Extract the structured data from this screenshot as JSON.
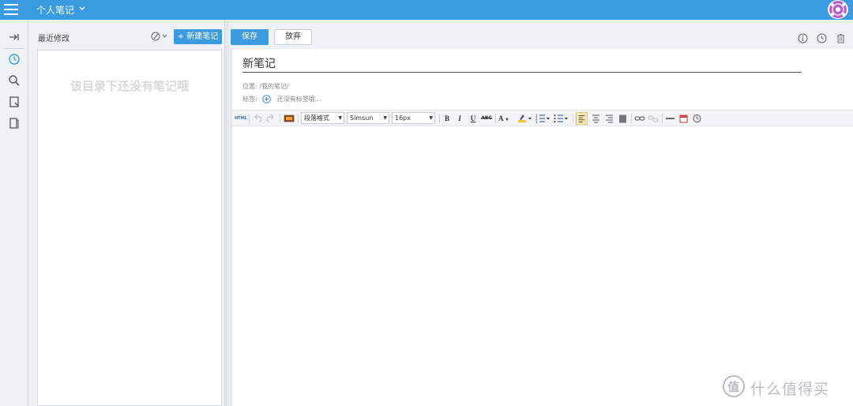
{
  "header": {
    "title": "个人笔记",
    "icons": {
      "menu": "hamburger-menu-icon",
      "chevron": "chevron-down-icon",
      "avatar": "user-avatar"
    }
  },
  "iconbar": {
    "items": [
      {
        "name": "collapse-icon"
      },
      {
        "name": "recent-clock-icon",
        "active": true
      },
      {
        "name": "search-icon"
      },
      {
        "name": "notebook-icon"
      },
      {
        "name": "tag-bookmark-icon"
      }
    ]
  },
  "list": {
    "title": "最近修改",
    "new_note_label": "+ 新建笔记",
    "empty_message": "该目录下还没有笔记哦"
  },
  "editor": {
    "save_label": "保存",
    "discard_label": "放弃",
    "note_title": "新笔记",
    "location_label": "位置:",
    "location_value": "/我的笔记/",
    "tags_label": "标签:",
    "tags_placeholder": "还没有标签哦..."
  },
  "toolbar": {
    "html_label": "HTML",
    "paragraph_format": "段落格式",
    "font_family": "Simsun",
    "font_size": "16px",
    "bold": "B",
    "italic": "I",
    "underline": "U",
    "strike": "ABC",
    "font_color": "A"
  },
  "colors": {
    "primary": "#3a9be0",
    "background": "#eef1f5",
    "active_align": "#fde9b6"
  },
  "watermark": {
    "text": "什么值得买"
  }
}
